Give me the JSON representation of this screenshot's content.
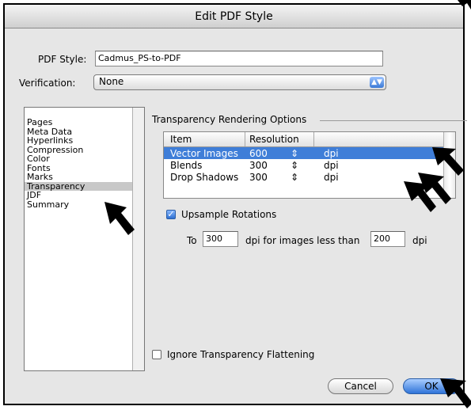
{
  "dialog": {
    "title": "Edit PDF Style"
  },
  "pdf_style": {
    "label": "PDF Style:",
    "value": "Cadmus_PS-to-PDF"
  },
  "verification": {
    "label": "Verification:",
    "value": "None"
  },
  "sidebar": {
    "items": [
      {
        "label": "Pages"
      },
      {
        "label": "Meta Data"
      },
      {
        "label": "Hyperlinks"
      },
      {
        "label": "Compression"
      },
      {
        "label": "Color"
      },
      {
        "label": "Fonts"
      },
      {
        "label": "Marks"
      },
      {
        "label": "Transparency"
      },
      {
        "label": "JDF"
      },
      {
        "label": "Summary"
      }
    ],
    "selected": "Transparency"
  },
  "transparency": {
    "group_title": "Transparency Rendering Options",
    "table": {
      "headers": [
        "Item",
        "Resolution"
      ],
      "rows": [
        {
          "item": "Vector Images",
          "resolution": "600",
          "unit": "dpi"
        },
        {
          "item": "Blends",
          "resolution": "300",
          "unit": "dpi"
        },
        {
          "item": "Drop Shadows",
          "resolution": "300",
          "unit": "dpi"
        }
      ],
      "stepper_glyph": "⇕"
    },
    "upsample": {
      "label": "Upsample Rotations",
      "checked": true
    },
    "upsample_line": {
      "to_label": "To",
      "dpi_value": "300",
      "middle_label": "dpi for images less than",
      "threshold_value": "200",
      "unit_label": "dpi"
    },
    "ignore_flattening": {
      "label": "Ignore Transparency Flattening",
      "checked": false
    }
  },
  "buttons": {
    "cancel": "Cancel",
    "ok": "OK"
  },
  "colors": {
    "selection": "#3f7ed8",
    "default_button": "#2f74d8"
  }
}
